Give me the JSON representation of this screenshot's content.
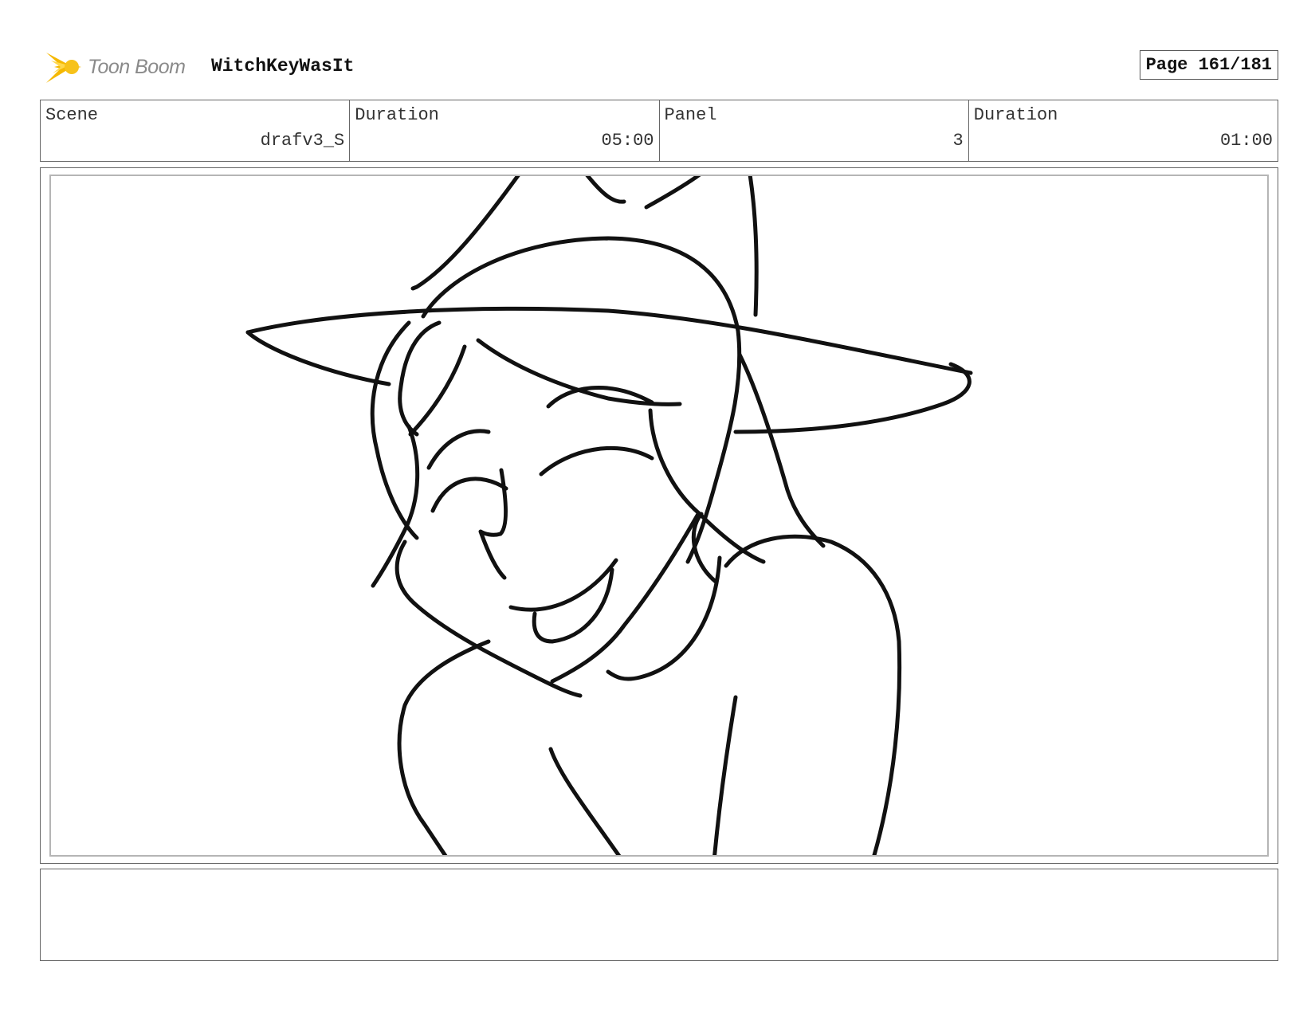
{
  "header": {
    "logo_text": "Toon Boom",
    "project_title": "WitchKeyWasIt",
    "page_label": "Page 161/181"
  },
  "info": {
    "scene_label": "Scene",
    "scene_value": "drafv3_S",
    "duration_label": "Duration",
    "duration_value": "05:00",
    "panel_label": "Panel",
    "panel_value": "3",
    "panel_duration_label": "Duration",
    "panel_duration_value": "01:00"
  },
  "panel": {
    "image": "sketch-witch-smiling",
    "line_color": "#111111"
  },
  "notes": {
    "text": ""
  },
  "colors": {
    "logo_accent": "#f5b800",
    "border": "#666666"
  }
}
